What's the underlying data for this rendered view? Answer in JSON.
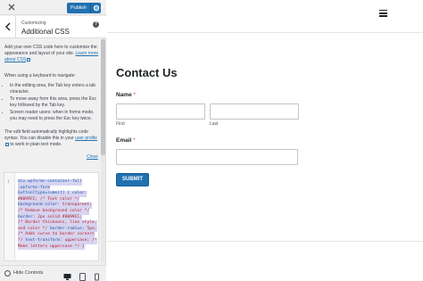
{
  "topbar": {
    "publish_label": "Publish"
  },
  "section": {
    "breadcrumb": "Customizing",
    "title": "Additional CSS",
    "help_label": "?"
  },
  "description": {
    "intro": "Add your own CSS code here to customize the appearance and layout of your site.",
    "learn_more_link": "Learn more about CSS",
    "keyboard_intro": "When using a keyboard to navigate:",
    "bullets": [
      "In the editing area, the Tab key enters a tab character.",
      "To move away from this area, press the Esc key followed by the Tab key.",
      "Screen reader users: when in forms mode, you may need to press the Esc key twice."
    ],
    "highlight_text": "The edit field automatically highlights code syntax. You can disable this in your",
    "profile_link": "user profile",
    "highlight_suffix": "to work in plain text mode.",
    "close_link": "Close"
  },
  "editor": {
    "line_number": "1",
    "code_lines": [
      {
        "parts": [
          {
            "t": "div.wpforms-container-full",
            "c": "sel"
          }
        ]
      },
      {
        "parts": [
          {
            "t": " .wpforms-form",
            "c": "sel"
          }
        ]
      },
      {
        "parts": [
          {
            "t": "button[type=submit] { ",
            "c": "sel"
          },
          {
            "t": "color:",
            "c": "prop"
          }
        ]
      },
      {
        "parts": [
          {
            "t": "#0099CC; ",
            "c": "val"
          },
          {
            "t": "/* Text color */",
            "c": "cmt"
          }
        ]
      },
      {
        "parts": [
          {
            "t": "background-color: ",
            "c": "prop"
          },
          {
            "t": "transparent;",
            "c": "val"
          }
        ]
      },
      {
        "parts": [
          {
            "t": "/* Remove background color */",
            "c": "cmt"
          }
        ]
      },
      {
        "parts": [
          {
            "t": "border: ",
            "c": "prop"
          },
          {
            "t": "2px solid #0099CC; ",
            "c": "val"
          }
        ]
      },
      {
        "parts": [
          {
            "t": "/* Border thickness, line style,",
            "c": "cmt"
          }
        ]
      },
      {
        "parts": [
          {
            "t": "and color */ ",
            "c": "cmt"
          },
          {
            "t": "border-radius: ",
            "c": "prop"
          },
          {
            "t": "5px;",
            "c": "val"
          }
        ]
      },
      {
        "parts": [
          {
            "t": "/* Adds curve to border corners",
            "c": "cmt"
          }
        ]
      },
      {
        "parts": [
          {
            "t": "*/ ",
            "c": "cmt"
          },
          {
            "t": "text-transform: ",
            "c": "prop"
          },
          {
            "t": "uppercase; ",
            "c": "val"
          },
          {
            "t": "/*",
            "c": "cmt"
          }
        ]
      },
      {
        "parts": [
          {
            "t": "Make letters uppercase */ }",
            "c": "cmt"
          }
        ]
      }
    ]
  },
  "bottom": {
    "hide_controls_label": "Hide Controls"
  },
  "preview": {
    "form_title": "Contact Us",
    "name_label": "Name",
    "required_mark": "*",
    "first_label": "First",
    "last_label": "Last",
    "email_label": "Email",
    "submit_label": "SUBMIT"
  },
  "colors": {
    "accent": "#2271b1",
    "required": "#d63638",
    "panel_bg": "#f0f0f1"
  },
  "icons": [
    "close-icon",
    "gear-icon",
    "chevron-left-icon",
    "help-icon",
    "external-link-icon",
    "hide-controls-icon",
    "desktop-icon",
    "tablet-icon",
    "mobile-icon",
    "hamburger-menu-icon"
  ]
}
